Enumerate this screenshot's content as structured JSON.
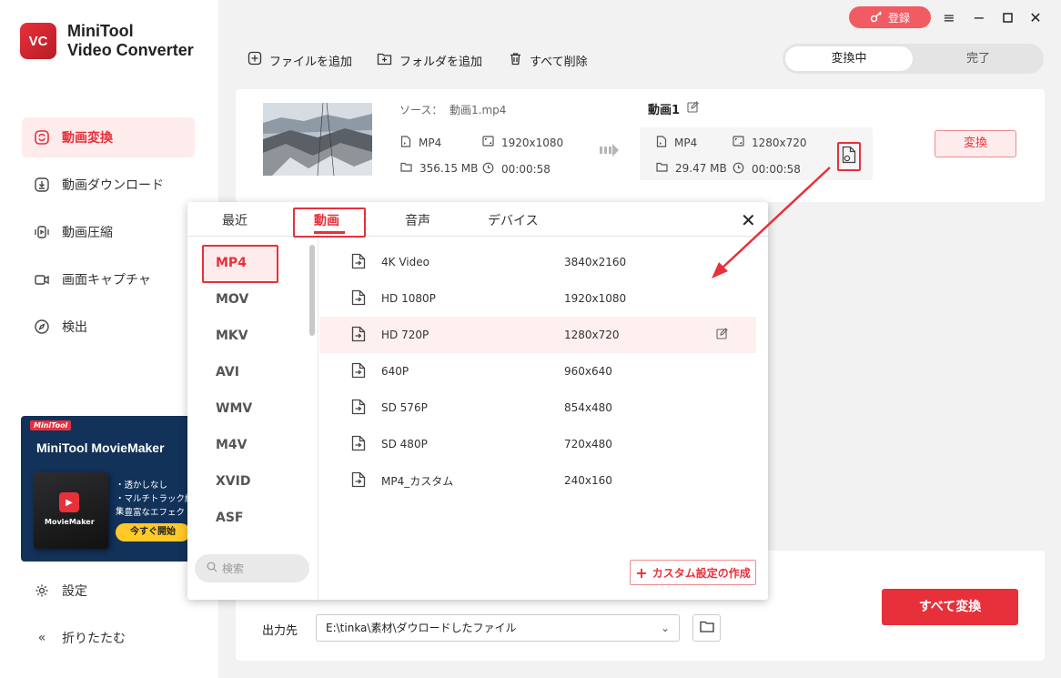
{
  "app": {
    "name_line1": "MiniTool",
    "name_line2": "Video Converter",
    "logo_text": "VC"
  },
  "topbar": {
    "register_label": "登録"
  },
  "sidebar": {
    "items": [
      {
        "label": "動画変換",
        "icon": "convert-icon"
      },
      {
        "label": "動画ダウンロード",
        "icon": "download-icon"
      },
      {
        "label": "動画圧縮",
        "icon": "compress-icon"
      },
      {
        "label": "画面キャプチャ",
        "icon": "camera-icon"
      },
      {
        "label": "検出",
        "icon": "compass-icon"
      }
    ],
    "settings_label": "設定",
    "collapse_label": "折りたたむ"
  },
  "ad": {
    "tag": "MiniTool",
    "title": "MiniTool MovieMaker",
    "box_name": "MovieMaker",
    "features": [
      "透かしなし",
      "マルチトラック編集",
      "豊富なエフェクト"
    ],
    "cta": "今すぐ開始"
  },
  "toolbar": {
    "add_file": "ファイルを追加",
    "add_folder": "フォルダを追加",
    "delete_all": "すべて削除",
    "tab_converting": "変換中",
    "tab_done": "完了"
  },
  "file": {
    "source_label": "ソース：",
    "source_name": "動画1.mp4",
    "source_format": "MP4",
    "source_resolution": "1920x1080",
    "source_size": "356.15 MB",
    "source_duration": "00:00:58",
    "target_name": "動画1",
    "target_format": "MP4",
    "target_resolution": "1280x720",
    "target_size": "29.47 MB",
    "target_duration": "00:00:58",
    "convert_label": "変換"
  },
  "popup": {
    "tabs": [
      "最近",
      "動画",
      "音声",
      "デバイス"
    ],
    "active_tab": "動画",
    "formats": [
      "MP4",
      "MOV",
      "MKV",
      "AVI",
      "WMV",
      "M4V",
      "XVID",
      "ASF"
    ],
    "active_format": "MP4",
    "search_placeholder": "検索",
    "presets": [
      {
        "name": "4K Video",
        "resolution": "3840x2160"
      },
      {
        "name": "HD 1080P",
        "resolution": "1920x1080"
      },
      {
        "name": "HD 720P",
        "resolution": "1280x720"
      },
      {
        "name": "640P",
        "resolution": "960x640"
      },
      {
        "name": "SD 576P",
        "resolution": "854x480"
      },
      {
        "name": "SD 480P",
        "resolution": "720x480"
      },
      {
        "name": "MP4_カスタム",
        "resolution": "240x160"
      }
    ],
    "highlighted_preset": "HD 720P",
    "custom_btn": "カスタム設定の作成"
  },
  "output": {
    "label": "出力先",
    "path": "E:\\tinka\\素材\\ダウロードしたファイル",
    "convert_all": "すべて変換"
  },
  "colors": {
    "accent": "#e8303b",
    "accent_light": "#fdeceb"
  }
}
